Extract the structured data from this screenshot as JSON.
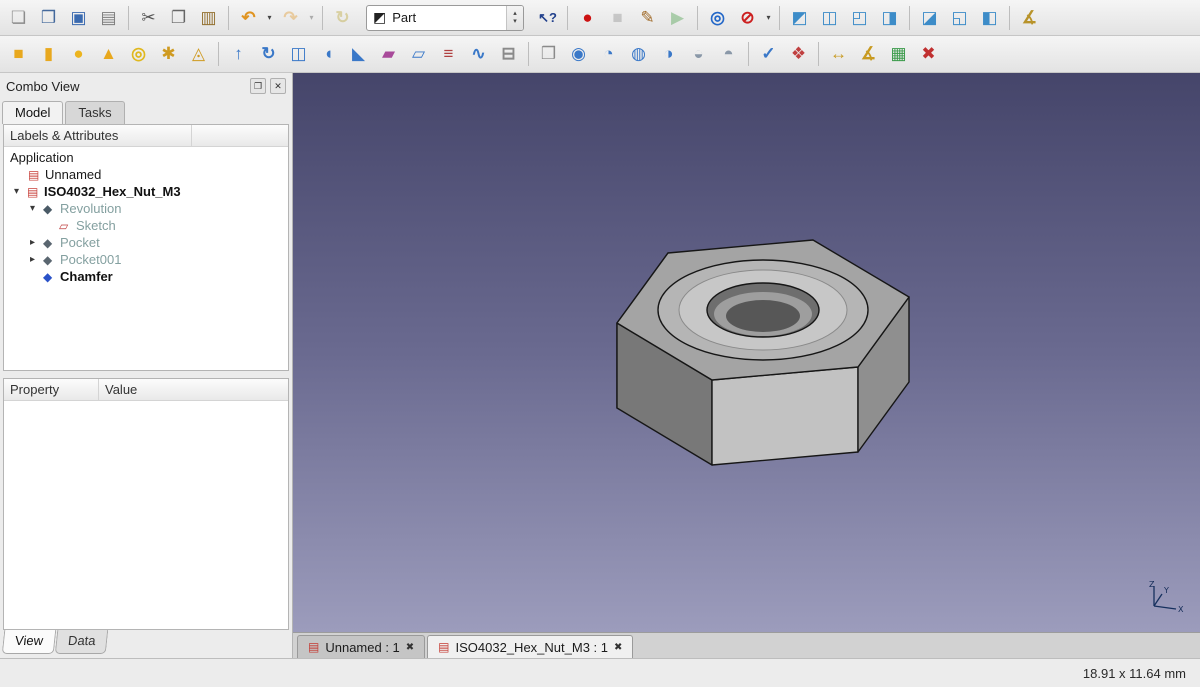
{
  "workbench": {
    "label": "Part",
    "icon": "◩",
    "up": "▴",
    "down": "▾"
  },
  "toolbar_main": {
    "left": [
      {
        "dname": "new-document-button",
        "glyph": "❏",
        "style": "color:#8c8c8c"
      },
      {
        "dname": "open-document-button",
        "glyph": "❒",
        "style": "color:#44699c"
      },
      {
        "dname": "save-button",
        "glyph": "▣",
        "style": "color:#3a6ab0"
      },
      {
        "dname": "print-button",
        "glyph": "▤",
        "style": "color:#7d7d7d"
      },
      {
        "dname": "separator",
        "cls": "sep",
        "inter": "false"
      },
      {
        "dname": "cut-button",
        "glyph": "✂",
        "style": "color:#555555"
      },
      {
        "dname": "copy-button",
        "glyph": "❐",
        "style": "color:#666666"
      },
      {
        "dname": "paste-button",
        "glyph": "▥",
        "style": "color:#93702f"
      },
      {
        "dname": "separator",
        "cls": "sep",
        "inter": "false"
      },
      {
        "dname": "undo-button",
        "glyph": "↶",
        "style": "color:#e09420;font-weight:bold"
      },
      {
        "dname": "undo-dropdown",
        "glyph": "▾",
        "cls": "drop"
      },
      {
        "dname": "redo-button",
        "glyph": "↷",
        "style": "color:#e09420;font-weight:bold",
        "cls": "tbtn dis"
      },
      {
        "dname": "redo-dropdown",
        "glyph": "▾",
        "cls": "drop dis"
      },
      {
        "dname": "separator",
        "cls": "sep",
        "inter": "false"
      },
      {
        "dname": "refresh-button",
        "glyph": "↻",
        "style": "color:#b8a22a;font-weight:bold",
        "cls": "tbtn dis"
      }
    ],
    "right": [
      {
        "dname": "whats-this-button",
        "glyph": "↖?",
        "style": "color:#22418c;font-weight:bold;font-size:13px"
      },
      {
        "dname": "separator",
        "cls": "sep",
        "inter": "false"
      },
      {
        "dname": "macro-record-button",
        "glyph": "●",
        "style": "color:#cc1212"
      },
      {
        "dname": "macro-stop-button",
        "glyph": "■",
        "style": "color:#8a8a8a",
        "cls": "tbtn dis"
      },
      {
        "dname": "macro-edit-button",
        "glyph": "✎",
        "style": "color:#a06a28"
      },
      {
        "dname": "macro-play-button",
        "glyph": "▶",
        "style": "color:#3f9a3f",
        "cls": "tbtn dis"
      },
      {
        "dname": "separator",
        "cls": "sep",
        "inter": "false"
      },
      {
        "dname": "view-fit-all-button",
        "glyph": "◎",
        "style": "color:#2468c8;font-weight:bold"
      },
      {
        "dname": "draw-style-button",
        "glyph": "⊘",
        "style": "color:#cc2020;font-weight:bold"
      },
      {
        "dname": "draw-style-dropdown",
        "glyph": "▾",
        "cls": "drop"
      },
      {
        "dname": "separator",
        "cls": "sep",
        "inter": "false"
      },
      {
        "dname": "view-axonometric-button",
        "glyph": "◩",
        "style": "color:#3d8cc8"
      },
      {
        "dname": "view-front-button",
        "glyph": "◫",
        "style": "color:#3d8cc8"
      },
      {
        "dname": "view-top-button",
        "glyph": "◰",
        "style": "color:#3d8cc8"
      },
      {
        "dname": "view-right-button",
        "glyph": "◨",
        "style": "color:#3d8cc8"
      },
      {
        "dname": "separator",
        "cls": "sep",
        "inter": "false"
      },
      {
        "dname": "view-rear-button",
        "glyph": "◪",
        "style": "color:#3d8cc8"
      },
      {
        "dname": "view-bottom-button",
        "glyph": "◱",
        "style": "color:#3d8cc8"
      },
      {
        "dname": "view-left-button",
        "glyph": "◧",
        "style": "color:#3d8cc8"
      },
      {
        "dname": "separator",
        "cls": "sep",
        "inter": "false"
      },
      {
        "dname": "measure-distance-button",
        "glyph": "∡",
        "style": "color:#b8932a;font-weight:bold"
      }
    ]
  },
  "toolbar_part": {
    "items": [
      {
        "dname": "part-box-button",
        "glyph": "■",
        "style": "color:#e8a81e"
      },
      {
        "dname": "part-cylinder-button",
        "glyph": "▮",
        "style": "color:#e8a81e"
      },
      {
        "dname": "part-sphere-button",
        "glyph": "●",
        "style": "color:#ecb41e"
      },
      {
        "dname": "part-cone-button",
        "glyph": "▲",
        "style": "color:#e8a81e"
      },
      {
        "dname": "part-torus-button",
        "glyph": "◎",
        "style": "color:#e0b81e;font-weight:bold"
      },
      {
        "dname": "part-primitives-button",
        "glyph": "✱",
        "style": "color:#cf9a20"
      },
      {
        "dname": "part-shapebuilder-button",
        "glyph": "◬",
        "style": "color:#cf9a20"
      },
      {
        "dname": "separator",
        "cls": "sep",
        "inter": "false"
      },
      {
        "dname": "part-extrude-button",
        "glyph": "↑",
        "style": "color:#3a78c8;font-weight:bold"
      },
      {
        "dname": "part-revolve-button",
        "glyph": "↻",
        "style": "color:#3a78c8;font-weight:bold"
      },
      {
        "dname": "part-mirror-button",
        "glyph": "◫",
        "style": "color:#3a78c8"
      },
      {
        "dname": "part-fillet-button",
        "glyph": "◖",
        "style": "color:#3a78c8"
      },
      {
        "dname": "part-chamfer-button",
        "glyph": "◣",
        "style": "color:#3a78c8"
      },
      {
        "dname": "part-makeface-button",
        "glyph": "▰",
        "style": "color:#a84a9a"
      },
      {
        "dname": "part-ruledsurface-button",
        "glyph": "▱",
        "style": "color:#3a78c8"
      },
      {
        "dname": "part-loft-button",
        "glyph": "≡",
        "style": "color:#b04040;font-weight:bold"
      },
      {
        "dname": "part-sweep-button",
        "glyph": "∿",
        "style": "color:#3a78c8;font-weight:bold"
      },
      {
        "dname": "part-section-button",
        "glyph": "⊟",
        "style": "color:#8a8a8a;font-weight:bold"
      },
      {
        "dname": "separator",
        "cls": "sep",
        "inter": "false"
      },
      {
        "dname": "part-compound-button",
        "glyph": "❒",
        "style": "color:#8a8a8a"
      },
      {
        "dname": "part-boolean-button",
        "glyph": "◉",
        "style": "color:#3a78c8"
      },
      {
        "dname": "part-cut-button",
        "glyph": "◔",
        "style": "color:#3a78c8"
      },
      {
        "dname": "part-union-button",
        "glyph": "◍",
        "style": "color:#3a78c8"
      },
      {
        "dname": "part-common-button",
        "glyph": "◑",
        "style": "color:#3a78c8"
      },
      {
        "dname": "part-connect-button",
        "glyph": "◒",
        "style": "color:#8a98a8"
      },
      {
        "dname": "part-split-button",
        "glyph": "◓",
        "style": "color:#8a98a8"
      },
      {
        "dname": "separator",
        "cls": "sep",
        "inter": "false"
      },
      {
        "dname": "part-check-geometry-button",
        "glyph": "✓",
        "style": "color:#3a78c8;font-weight:bold"
      },
      {
        "dname": "part-refine-shape-button",
        "glyph": "❖",
        "style": "color:#c04040"
      },
      {
        "dname": "separator",
        "cls": "sep",
        "inter": "false"
      },
      {
        "dname": "measure-linear-button",
        "glyph": "↔",
        "style": "color:#c89a20;font-weight:bold"
      },
      {
        "dname": "measure-angular-button",
        "glyph": "∡",
        "style": "color:#c89a20;font-weight:bold"
      },
      {
        "dname": "measure-toggle-all-button",
        "glyph": "▦",
        "style": "color:#3a9a4a"
      },
      {
        "dname": "measure-clear-all-button",
        "glyph": "✖",
        "style": "color:#c03030"
      }
    ]
  },
  "combo_view": {
    "title": "Combo View",
    "float_icon": "❐",
    "close_icon": "✕",
    "tabs": [
      {
        "label": "Model",
        "cls": "cvtab active",
        "dname": "tab-model"
      },
      {
        "label": "Tasks",
        "cls": "cvtab",
        "dname": "tab-tasks"
      }
    ],
    "tree_header": "Labels & Attributes",
    "tree_items": [
      {
        "dname": "tree-item-application",
        "label": "Application",
        "row_style": "padding-left:6px",
        "label_style": "color:#1a1a1a"
      },
      {
        "dname": "tree-item-unnamed",
        "label": "Unnamed",
        "row_style": "padding-left:24px",
        "glyph": "▤",
        "icon_style": "color:#c8403a",
        "label_style": "color:#1a1a1a"
      },
      {
        "dname": "tree-item-iso4032-hex-nut-m3",
        "label": "ISO4032_Hex_Nut_M3",
        "row_style": "padding-left:10px",
        "expander": "▾",
        "glyph": "▤",
        "icon_style": "color:#c8403a",
        "label_style": "color:#111111;font-weight:bold"
      },
      {
        "dname": "tree-item-revolution",
        "label": "Revolution",
        "row_style": "padding-left:26px",
        "expander": "▾",
        "glyph": "◆",
        "icon_style": "color:#4a5a66",
        "label_style": "color:#84a0a0"
      },
      {
        "dname": "tree-item-sketch",
        "label": "Sketch",
        "row_style": "padding-left:55px",
        "glyph": "▱",
        "icon_style": "color:#c04040",
        "label_style": "color:#84a0a0"
      },
      {
        "dname": "tree-item-pocket",
        "label": "Pocket",
        "row_style": "padding-left:26px",
        "expander": "▸",
        "glyph": "◆",
        "icon_style": "color:#5a6670",
        "label_style": "color:#84a0a0"
      },
      {
        "dname": "tree-item-pocket001",
        "label": "Pocket001",
        "row_style": "padding-left:26px",
        "expander": "▸",
        "glyph": "◆",
        "icon_style": "color:#5a6670",
        "label_style": "color:#84a0a0"
      },
      {
        "dname": "tree-item-chamfer",
        "label": "Chamfer",
        "row_style": "padding-left:39px",
        "glyph": "◆",
        "icon_style": "color:#2a52c8",
        "label_style": "color:#111111;font-weight:bold"
      }
    ],
    "property_table": {
      "col1": "Property",
      "col2": "Value"
    },
    "bottom_tabs": [
      {
        "label": "View",
        "cls": "btab active",
        "dname": "tab-view"
      },
      {
        "label": "Data",
        "cls": "btab",
        "dname": "tab-data"
      }
    ]
  },
  "viewport": {
    "doc_tabs": [
      {
        "label": "Unnamed : 1",
        "cls": "dtab",
        "dname": "doc-tab-unnamed",
        "gl": "▤",
        "cl": "✖"
      },
      {
        "label": "ISO4032_Hex_Nut_M3 : 1",
        "cls": "dtab active",
        "dname": "doc-tab-iso4032",
        "gl": "▤",
        "cl": "✖"
      }
    ],
    "axis_z": "Z",
    "axis_y": "Y",
    "axis_x": "X"
  },
  "statusbar": {
    "dimensions": "18.91 x 11.64 mm"
  }
}
